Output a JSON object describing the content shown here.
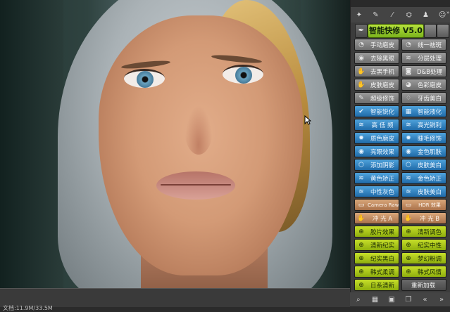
{
  "status": {
    "text": "文档:11.9M/33.5M"
  },
  "panel": {
    "toolbar_icons": [
      "wand-icon",
      "pencil-icon",
      "brush-icon",
      "stamp-icon",
      "user-icon",
      "person-icon"
    ],
    "title": {
      "label": "智能快修 V5.0"
    },
    "rows": [
      [
        {
          "label": "手动磨皮",
          "color": "gray",
          "icon": "face-icon"
        },
        {
          "label": "线一祛斑",
          "color": "gray",
          "icon": "face-icon"
        }
      ],
      [
        {
          "label": "去除黑眼",
          "color": "gray",
          "icon": "eye-icon"
        },
        {
          "label": "分层处理",
          "color": "gray",
          "icon": "layers-icon"
        }
      ],
      [
        {
          "label": "去黑手机",
          "color": "gray",
          "icon": "hand-icon"
        },
        {
          "label": "D&B处理",
          "color": "gray",
          "icon": "camera-icon"
        }
      ],
      [
        {
          "label": "皮肤磨皮",
          "color": "gray",
          "icon": "hand-icon"
        },
        {
          "label": "色彩磨皮",
          "color": "gray",
          "icon": "palette-icon"
        }
      ],
      [
        {
          "label": "超级修饰",
          "color": "gray",
          "icon": "brush-icon"
        },
        {
          "label": "牙齿美白",
          "color": "gray",
          "icon": "tooth-icon"
        }
      ],
      [
        {
          "label": "智能锐化",
          "color": "blue",
          "icon": "check-icon"
        },
        {
          "label": "智能液化",
          "color": "blue",
          "icon": "grid-icon"
        }
      ],
      [
        {
          "label": "高 低 频",
          "color": "blue",
          "icon": "layers-icon"
        },
        {
          "label": "高光锐利",
          "color": "blue",
          "icon": "layers-icon"
        }
      ],
      [
        {
          "label": "质色磨皮",
          "color": "blue",
          "icon": "gear-icon"
        },
        {
          "label": "睫毛修饰",
          "color": "blue",
          "icon": "gear-icon"
        }
      ],
      [
        {
          "label": "亮眼效果",
          "color": "blue",
          "icon": "eye-icon"
        },
        {
          "label": "金色肌肤",
          "color": "blue",
          "icon": "eye-icon"
        }
      ],
      [
        {
          "label": "添加阴影",
          "color": "blue",
          "icon": "shield-icon"
        },
        {
          "label": "皮肤美白",
          "color": "blue",
          "icon": "shield-icon"
        }
      ],
      [
        {
          "label": "黄色矫正",
          "color": "blue",
          "icon": "layers-icon"
        },
        {
          "label": "金色矫正",
          "color": "blue",
          "icon": "layers-icon"
        }
      ],
      [
        {
          "label": "中性灰色",
          "color": "blue",
          "icon": "layers-icon"
        },
        {
          "label": "皮肤美白",
          "color": "blue",
          "icon": "layers-icon"
        }
      ],
      [
        {
          "label": "Camera Raw",
          "color": "tan",
          "icon": "square-icon",
          "small": true
        },
        {
          "label": "HDR 效果",
          "color": "tan",
          "icon": "square-icon",
          "small": true
        }
      ],
      [
        {
          "label": "冲 光 A",
          "color": "tan",
          "icon": "hand-icon"
        },
        {
          "label": "冲 光 B",
          "color": "tan",
          "icon": "hand-icon"
        }
      ],
      [
        {
          "label": "胶片效果",
          "color": "green",
          "icon": "globe-icon"
        },
        {
          "label": "清新调色",
          "color": "green",
          "icon": "globe-icon"
        }
      ],
      [
        {
          "label": "清新纪实",
          "color": "green",
          "icon": "globe-icon"
        },
        {
          "label": "纪实中性",
          "color": "green",
          "icon": "globe-icon"
        }
      ],
      [
        {
          "label": "纪实黑白",
          "color": "green",
          "icon": "globe-icon"
        },
        {
          "label": "梦幻粉调",
          "color": "green",
          "icon": "globe-icon"
        }
      ],
      [
        {
          "label": "韩式柔调",
          "color": "green",
          "icon": "globe-icon"
        },
        {
          "label": "韩式风情",
          "color": "green",
          "icon": "globe-icon"
        }
      ],
      [
        {
          "label": "日系清新",
          "color": "green",
          "icon": "globe-icon"
        },
        {
          "label": "重新加载",
          "color": "dark",
          "icon": ""
        }
      ]
    ],
    "bottom_icons": [
      "search-icon",
      "square-icon",
      "grid-icon",
      "copy-icon",
      "chevron-left-icon",
      "chevron-right-icon"
    ]
  }
}
